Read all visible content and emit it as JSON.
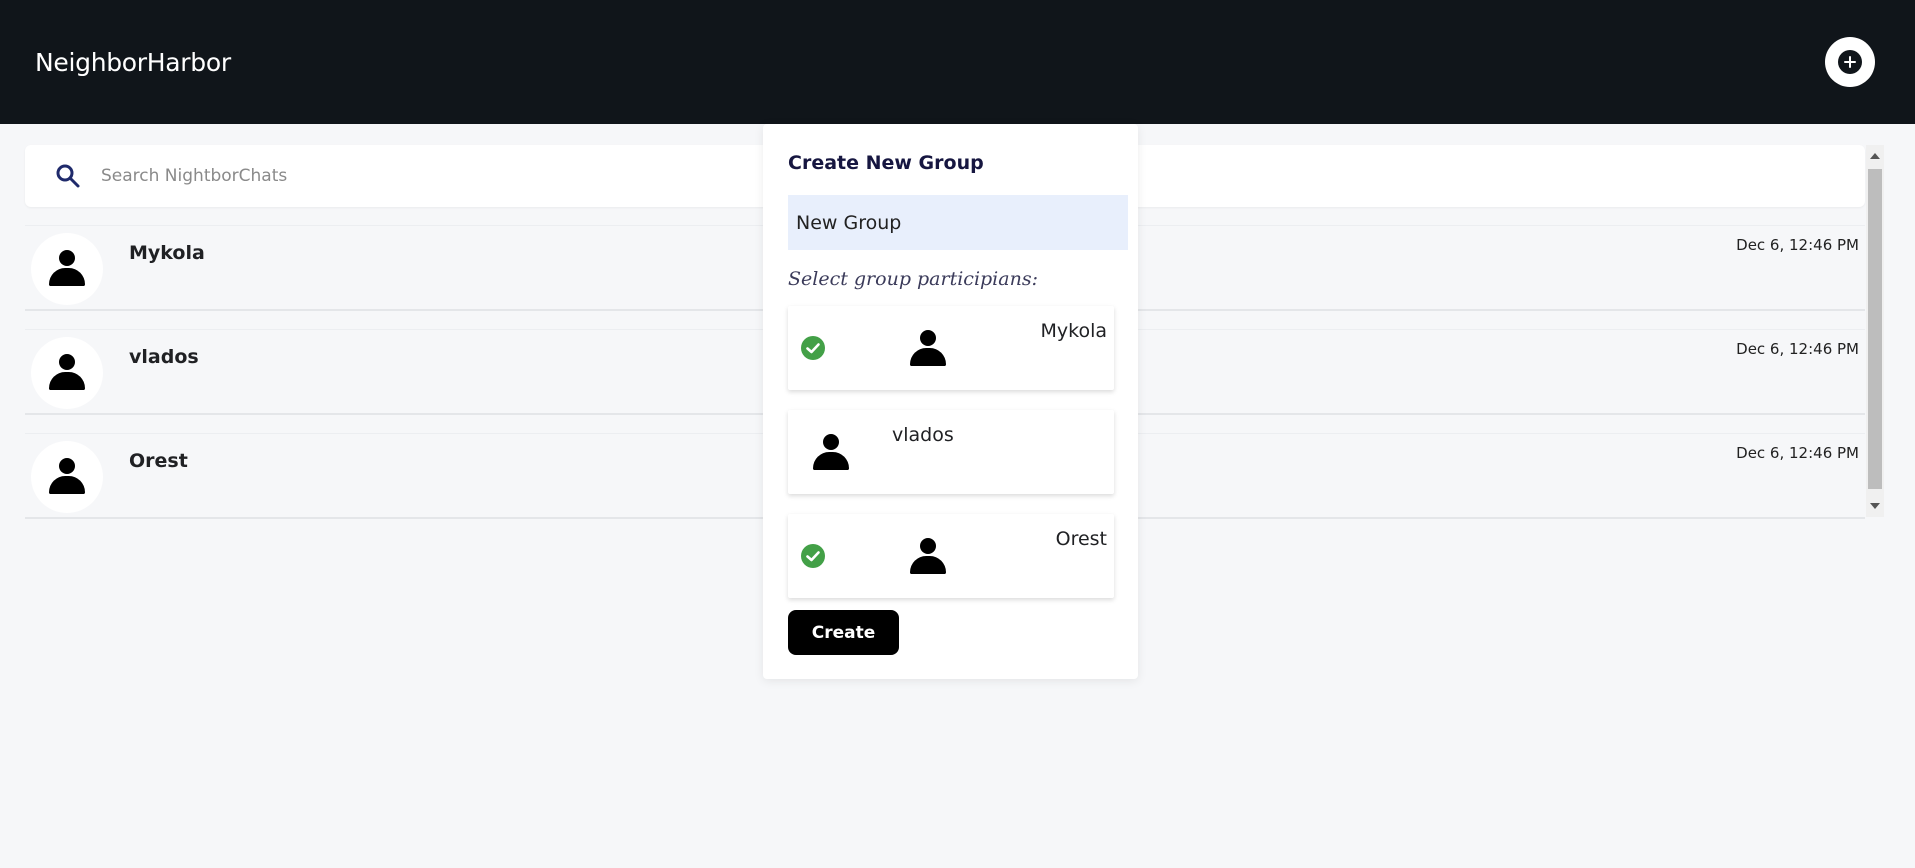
{
  "header": {
    "app_title": "NeighborHarbor",
    "add_icon": "plus-circle-icon"
  },
  "search": {
    "placeholder": "Search NightborChats",
    "value": "",
    "icon": "search-icon"
  },
  "chats": [
    {
      "name": "Mykola",
      "time": "Dec 6, 12:46 PM"
    },
    {
      "name": "vlados",
      "time": "Dec 6, 12:46 PM"
    },
    {
      "name": "Orest",
      "time": "Dec 6, 12:46 PM"
    }
  ],
  "modal": {
    "title": "Create New Group",
    "group_name_value": "New Group",
    "participants_label": "Select group participians:",
    "participants": [
      {
        "name": "Mykola",
        "selected": true
      },
      {
        "name": "vlados",
        "selected": false
      },
      {
        "name": "Orest",
        "selected": true
      }
    ],
    "create_label": "Create"
  },
  "colors": {
    "header_bg": "#10151a",
    "page_bg": "#f6f7f9",
    "check_green": "#43a047",
    "input_bg": "#e8effc"
  }
}
